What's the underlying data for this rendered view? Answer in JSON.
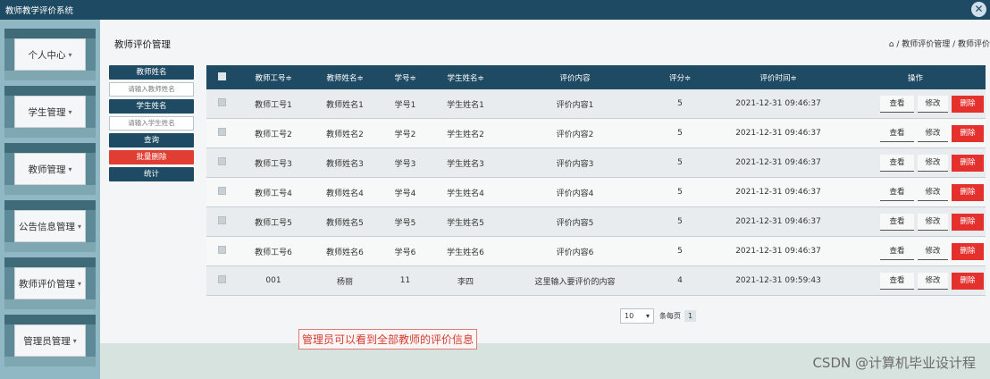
{
  "app": {
    "title": "教师教学评价系统",
    "close_icon": "close-icon"
  },
  "sidebar": {
    "items": [
      {
        "label": "个人中心",
        "chevron": "▾"
      },
      {
        "label": "学生管理",
        "chevron": "▾"
      },
      {
        "label": "教师管理",
        "chevron": "▾"
      },
      {
        "label": "公告信息管理",
        "chevron": "▾"
      },
      {
        "label": "教师评价管理",
        "chevron": "▾"
      },
      {
        "label": "管理员管理",
        "chevron": "▾"
      }
    ]
  },
  "page": {
    "title": "教师评价管理",
    "breadcrumb": "/ 教师评价管理 / 教师评价",
    "home_icon": "home-icon"
  },
  "filters": {
    "teacher_name_label": "教师姓名",
    "teacher_name_placeholder": "请输入教师姓名",
    "student_name_label": "学生姓名",
    "student_name_placeholder": "请输入学生姓名",
    "search_button": "查询",
    "batch_delete_button": "批量删除",
    "stats_button": "统计"
  },
  "table": {
    "headers": [
      "教师工号≑",
      "教师姓名≑",
      "学号≑",
      "学生姓名≑",
      "评价内容",
      "评分≑",
      "评价时间≑",
      "操作"
    ],
    "rows": [
      {
        "teacher_id": "教师工号1",
        "teacher_name": "教师姓名1",
        "student_id": "学号1",
        "student_name": "学生姓名1",
        "content": "评价内容1",
        "score": "5",
        "time": "2021-12-31 09:46:37"
      },
      {
        "teacher_id": "教师工号2",
        "teacher_name": "教师姓名2",
        "student_id": "学号2",
        "student_name": "学生姓名2",
        "content": "评价内容2",
        "score": "5",
        "time": "2021-12-31 09:46:37"
      },
      {
        "teacher_id": "教师工号3",
        "teacher_name": "教师姓名3",
        "student_id": "学号3",
        "student_name": "学生姓名3",
        "content": "评价内容3",
        "score": "5",
        "time": "2021-12-31 09:46:37"
      },
      {
        "teacher_id": "教师工号4",
        "teacher_name": "教师姓名4",
        "student_id": "学号4",
        "student_name": "学生姓名4",
        "content": "评价内容4",
        "score": "5",
        "time": "2021-12-31 09:46:37"
      },
      {
        "teacher_id": "教师工号5",
        "teacher_name": "教师姓名5",
        "student_id": "学号5",
        "student_name": "学生姓名5",
        "content": "评价内容5",
        "score": "5",
        "time": "2021-12-31 09:46:37"
      },
      {
        "teacher_id": "教师工号6",
        "teacher_name": "教师姓名6",
        "student_id": "学号6",
        "student_name": "学生姓名6",
        "content": "评价内容6",
        "score": "5",
        "time": "2021-12-31 09:46:37"
      },
      {
        "teacher_id": "001",
        "teacher_name": "杨丽",
        "student_id": "11",
        "student_name": "李四",
        "content": "这里输入要评价的内容",
        "score": "4",
        "time": "2021-12-31 09:59:43"
      }
    ],
    "actions": {
      "view": "查看",
      "edit": "修改",
      "delete": "删除"
    }
  },
  "pagination": {
    "page_size": "10",
    "per_page_label": "条每页",
    "current_page": "1"
  },
  "annotation": "管理员可以看到全部教师的评价信息",
  "watermark": "CSDN @计算机毕业设计程",
  "colors": {
    "primary": "#1e4a63",
    "danger": "#e5312e",
    "sidebar": "#8fb8c4"
  }
}
